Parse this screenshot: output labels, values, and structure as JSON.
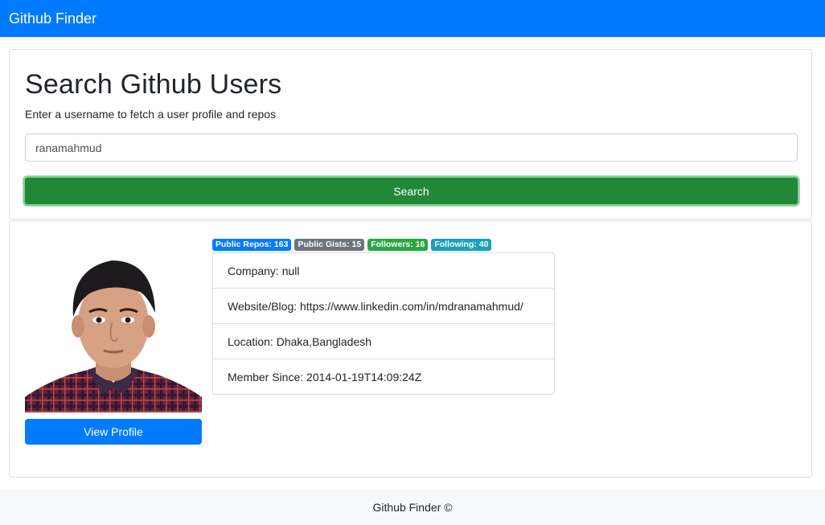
{
  "navbar": {
    "brand": "Github Finder"
  },
  "search": {
    "title": "Search Github Users",
    "subtitle": "Enter a username to fetch a user profile and repos",
    "input_value": "ranamahmud",
    "button_label": "Search"
  },
  "profile": {
    "view_profile_label": "View Profile",
    "badges": {
      "repos": "Public Repos: 163",
      "gists": "Public Gists: 15",
      "followers": "Followers: 16",
      "following": "Following: 40"
    },
    "details": {
      "company": "Company: null",
      "website": "Website/Blog: https://www.linkedin.com/in/mdranamahmud/",
      "location": "Location: Dhaka,Bangladesh",
      "member_since": "Member Since: 2014-01-19T14:09:24Z"
    }
  },
  "footer": {
    "text": "Github Finder ©"
  },
  "colors": {
    "navbar": "#007bff",
    "search_button": "#218838",
    "view_button": "#007bff",
    "badge_repos": "#007bff",
    "badge_gists": "#6c757d",
    "badge_followers": "#28a745",
    "badge_following": "#17a2b8"
  }
}
